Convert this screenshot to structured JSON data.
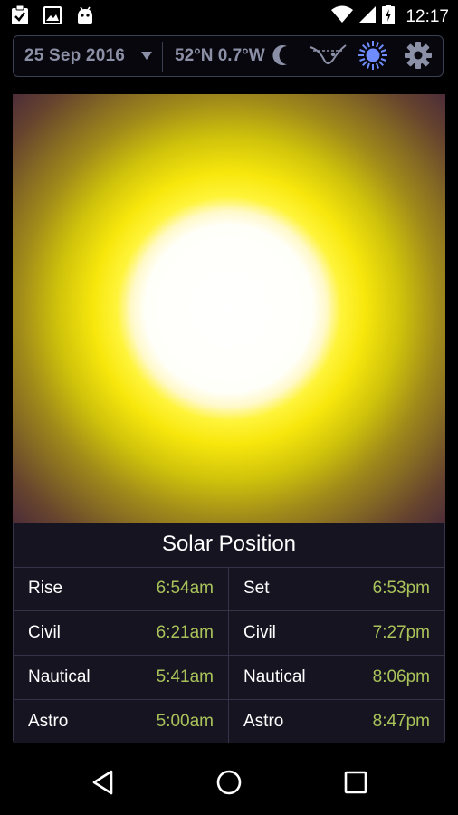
{
  "status_bar": {
    "time": "12:17",
    "icons_left": [
      "clipboard-check-icon",
      "image-icon",
      "android-icon"
    ],
    "icons_right": [
      "wifi-icon",
      "signal-icon",
      "battery-charging-icon"
    ]
  },
  "toolbar": {
    "date": "25 Sep 2016",
    "coordinates": "52°N  0.7°W",
    "buttons": [
      "moon-icon",
      "tides-icon",
      "sun-icon",
      "settings-gear-icon"
    ]
  },
  "colors": {
    "value_green": "#a9c35a",
    "label_muted": "#8c90a6",
    "sun_core": "#ffffff",
    "sun_glow": "#f7e70c",
    "active_sun_icon": "#6f8cff"
  },
  "solar": {
    "title": "Solar Position",
    "rows": [
      {
        "left_label": "Rise",
        "left_value": "6:54am",
        "right_label": "Set",
        "right_value": "6:53pm"
      },
      {
        "left_label": "Civil",
        "left_value": "6:21am",
        "right_label": "Civil",
        "right_value": "7:27pm"
      },
      {
        "left_label": "Nautical",
        "left_value": "5:41am",
        "right_label": "Nautical",
        "right_value": "8:06pm"
      },
      {
        "left_label": "Astro",
        "left_value": "5:00am",
        "right_label": "Astro",
        "right_value": "8:47pm"
      }
    ]
  },
  "nav_bar": {
    "buttons": [
      "back-icon",
      "home-icon",
      "recents-icon"
    ]
  }
}
